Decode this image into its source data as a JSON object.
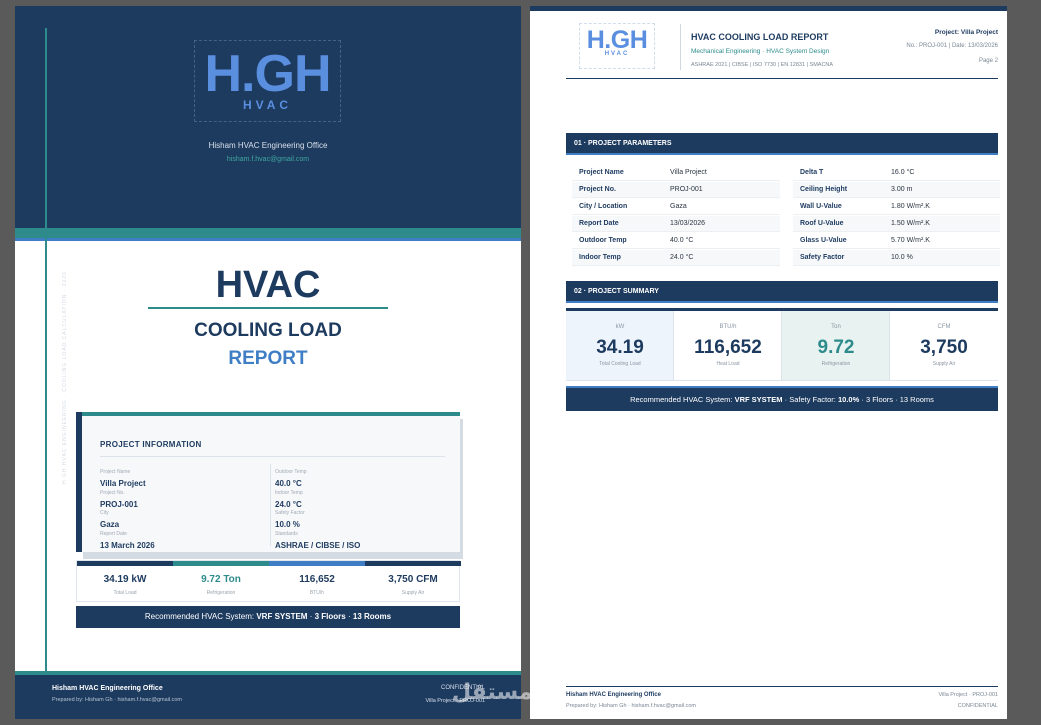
{
  "brand": {
    "logo_main": "H.GH",
    "logo_sub": "HVAC",
    "office": "Hisham HVAC Engineering Office",
    "email": "hisham.f.hvac@gmail.com"
  },
  "cover": {
    "side_text": "H.GH HVAC ENGINEERING · COOLING LOAD CALCULATION · 2026",
    "title": "HVAC",
    "subtitle1": "COOLING LOAD",
    "subtitle2": "REPORT",
    "info": {
      "heading": "PROJECT INFORMATION",
      "left": [
        {
          "label": "Project Name",
          "value": "Villa Project"
        },
        {
          "label": "Project No.",
          "value": "PROJ-001"
        },
        {
          "label": "City",
          "value": "Gaza"
        },
        {
          "label": "Report Date",
          "value": "13 March 2026"
        }
      ],
      "right": [
        {
          "label": "Outdoor Temp",
          "value": "40.0 °C"
        },
        {
          "label": "Indoor Temp",
          "value": "24.0 °C"
        },
        {
          "label": "Safety Factor",
          "value": "10.0 %"
        },
        {
          "label": "Standards",
          "value": "ASHRAE / CIBSE / ISO"
        }
      ]
    },
    "stats": [
      {
        "value": "34.19 kW",
        "label": "Total Load",
        "color": "#1d3a5f"
      },
      {
        "value": "9.72 Ton",
        "label": "Refrigeration",
        "color": "#2e8b8b"
      },
      {
        "value": "116,652",
        "label": "BTU/h",
        "color": "#3f7ec4"
      },
      {
        "value": "3,750 CFM",
        "label": "Supply Air",
        "color": "#1d3a5f"
      }
    ],
    "recommendation": {
      "prefix": "Recommended HVAC System:",
      "system": "VRF SYSTEM",
      "sep1": "·",
      "floors": "3 Floors",
      "sep2": "·",
      "rooms": "13 Rooms"
    },
    "footer": {
      "office": "Hisham HVAC Engineering Office",
      "prepared_by": "Prepared by: Hisham Gh",
      "sep": "·",
      "email": "hisham.f.hvac@gmail.com",
      "confidential": "CONFIDENTIAL",
      "project": "Villa Project",
      "sep2": "·",
      "project_no": "PROJ-001"
    }
  },
  "page2": {
    "title": "HVAC COOLING LOAD REPORT",
    "sub_left": "Mechanical Engineering",
    "sub_sep": "·",
    "sub_right": "HVAC System Design",
    "standards": "ASHRAE 2021 | CIBSE | ISO 7730 | EN 12831 | SMACNA",
    "project": "Project: Villa Project",
    "no_date": "No.: PROJ-001  |  Date: 13/03/2026",
    "page": "Page 2",
    "sec1": "01 · PROJECT PARAMETERS",
    "params_left": [
      {
        "key": "Project Name",
        "value": "Villa Project"
      },
      {
        "key": "Project No.",
        "value": "PROJ-001"
      },
      {
        "key": "City / Location",
        "value": "Gaza"
      },
      {
        "key": "Report Date",
        "value": "13/03/2026"
      },
      {
        "key": "Outdoor Temp",
        "value": "40.0 °C"
      },
      {
        "key": "Indoor Temp",
        "value": "24.0 °C"
      }
    ],
    "params_right": [
      {
        "key": "Delta T",
        "value": "16.0 °C"
      },
      {
        "key": "Ceiling Height",
        "value": "3.00 m"
      },
      {
        "key": "Wall U-Value",
        "value": "1.80 W/m².K"
      },
      {
        "key": "Roof U-Value",
        "value": "1.50 W/m².K"
      },
      {
        "key": "Glass U-Value",
        "value": "5.70 W/m².K"
      },
      {
        "key": "Safety Factor",
        "value": "10.0 %"
      }
    ],
    "sec2": "02 · PROJECT SUMMARY",
    "summary": [
      {
        "unit": "kW",
        "value": "34.19",
        "label": "Total Cooling Load",
        "bg": "#eef4fc",
        "color": "#1d3a5f"
      },
      {
        "unit": "BTU/h",
        "value": "116,652",
        "label": "Heat Load",
        "bg": "#ffffff",
        "color": "#1d3a5f"
      },
      {
        "unit": "Ton",
        "value": "9.72",
        "label": "Refrigeration",
        "bg": "#e8f3f1",
        "color": "#2e8b8b"
      },
      {
        "unit": "CFM",
        "value": "3,750",
        "label": "Supply Air",
        "bg": "#ffffff",
        "color": "#1d3a5f"
      }
    ],
    "recommendation": {
      "prefix": "Recommended HVAC System:",
      "system": "VRF SYSTEM",
      "sep1": "·",
      "safety_prefix": "Safety Factor:",
      "safety": "10.0%",
      "sep2": "·",
      "floors": "3 Floors",
      "sep3": "·",
      "rooms": "13 Rooms"
    },
    "footer": {
      "office": "Hisham HVAC Engineering Office",
      "prepared_by": "Prepared by: Hisham Gh",
      "sep": "·",
      "email": "hisham.f.hvac@gmail.com",
      "project": "Villa Project",
      "sep2": "·",
      "project_no": "PROJ-001",
      "confidential": "CONFIDENTIAL"
    }
  },
  "watermark": "مستقل"
}
